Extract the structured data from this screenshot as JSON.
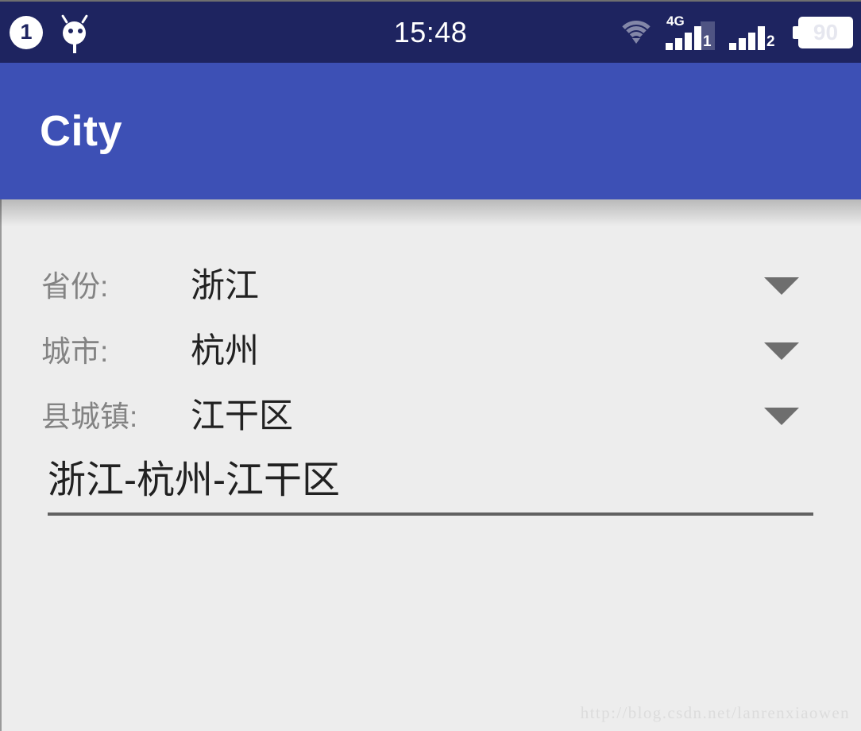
{
  "status_bar": {
    "notification_badge": "1",
    "android_icon": "android-robot-icon",
    "clock": "15:48",
    "wifi_icon": "wifi-icon",
    "sim1": {
      "network": "4G",
      "slot": "1",
      "bars": 4
    },
    "sim2": {
      "network": "",
      "slot": "2",
      "bars": 4
    },
    "battery": {
      "level": "90"
    },
    "background_color": "#1e2460"
  },
  "app_bar": {
    "title": "City",
    "background_color": "#3d50b5",
    "text_color": "#ffffff"
  },
  "content": {
    "background_color": "#ededed",
    "rows": [
      {
        "label": "省份:",
        "value": "浙江",
        "caret": "chevron-down-icon"
      },
      {
        "label": "城市:",
        "value": "杭州",
        "caret": "chevron-down-icon"
      },
      {
        "label": "县城镇:",
        "value": "江干区",
        "caret": "chevron-down-icon"
      }
    ],
    "result_field": {
      "value": "浙江-杭州-江干区",
      "placeholder": ""
    },
    "label_color": "#838383",
    "value_color": "#212121"
  },
  "watermark": {
    "text": "http://blog.csdn.net/lanrenxiaowen"
  }
}
